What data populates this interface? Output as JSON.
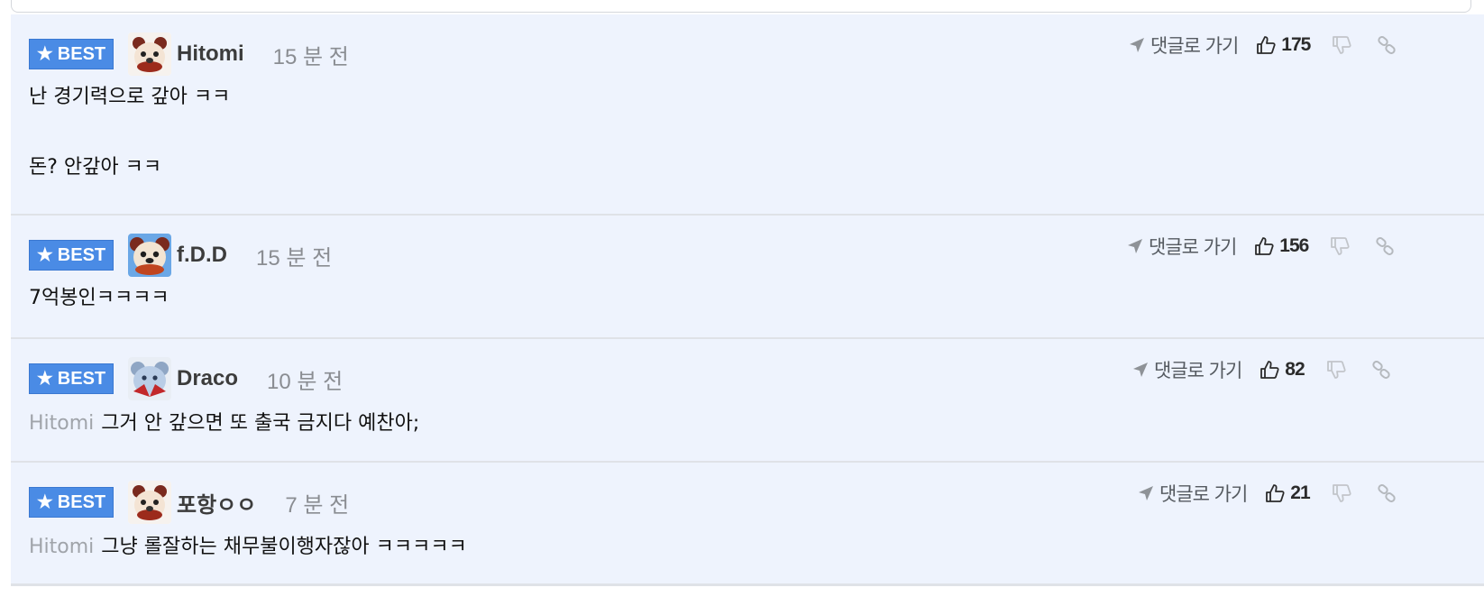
{
  "colors": {
    "best_badge": "#4a8be5",
    "comment_bg": "#eef3fd",
    "mention": "#a0a4aa",
    "time": "#8a8d92"
  },
  "badge_label": "BEST",
  "comments": [
    {
      "nickname": "Hitomi",
      "time": "15 분 전",
      "reply_label": "댓글로 가기",
      "likes": "175",
      "mention": "",
      "lines": [
        "난 경기력으로 갚아 ㅋㅋ",
        "돈? 안갚아 ㅋㅋ"
      ]
    },
    {
      "nickname": "f.D.D",
      "time": "15 분 전",
      "reply_label": "댓글로 가기",
      "likes": "156",
      "mention": "",
      "lines": [
        "7억봉인ㅋㅋㅋㅋ"
      ]
    },
    {
      "nickname": "Draco",
      "time": "10 분 전",
      "reply_label": "댓글로 가기",
      "likes": "82",
      "mention": "Hitomi",
      "lines": [
        "그거 안 갚으면 또 출국 금지다 예찬아;"
      ]
    },
    {
      "nickname": "포항ㅇㅇ",
      "time": "7 분 전",
      "reply_label": "댓글로 가기",
      "likes": "21",
      "mention": "Hitomi",
      "lines": [
        "그냥 롤잘하는 채무불이행자잖아 ㅋㅋㅋㅋㅋ"
      ]
    }
  ],
  "icons": {
    "badge": "star-icon",
    "reply": "arrow-pointer-icon",
    "like": "thumbs-up-icon",
    "dislike": "thumbs-down-icon",
    "share": "link-icon"
  }
}
